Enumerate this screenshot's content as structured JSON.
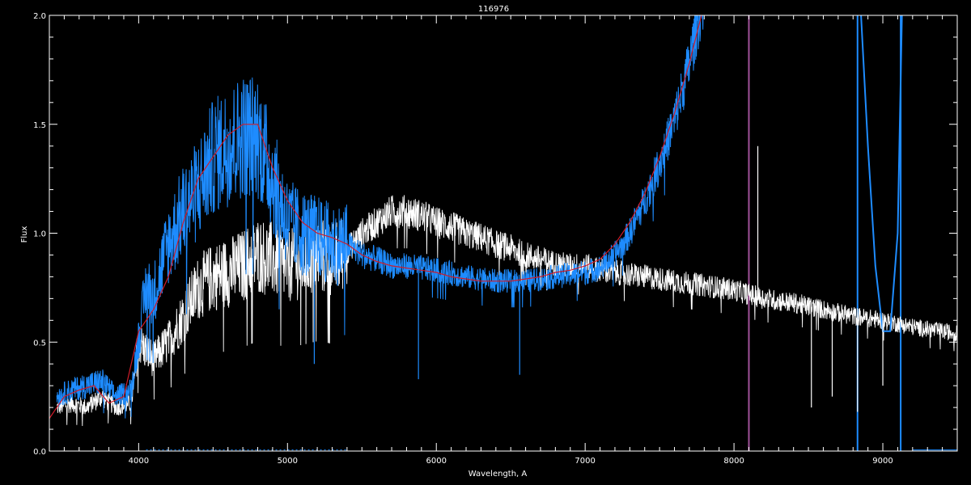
{
  "chart_data": {
    "type": "line",
    "title": "116976",
    "xlabel": "Wavelength, A",
    "ylabel": "Flux",
    "xlim": [
      3400,
      9500
    ],
    "ylim": [
      0.0,
      2.0
    ],
    "x_ticks": [
      4000,
      5000,
      6000,
      7000,
      8000,
      9000
    ],
    "y_ticks": [
      0.0,
      0.5,
      1.0,
      1.5,
      2.0
    ],
    "y_tick_labels": [
      "0.0",
      "0.5",
      "1.0",
      "1.5",
      "2.0"
    ],
    "grid": false,
    "colors": {
      "background": "#000000",
      "axes": "#ffffff",
      "series_white": "#ffffff",
      "series_blue": "#1e8cff",
      "series_red": "#d01c2a",
      "marker_line": "#a0529a"
    },
    "series": [
      {
        "color_key": "series_white",
        "style": "noisy",
        "x": [
          3450,
          3550,
          3650,
          3750,
          3850,
          3950,
          4000,
          4100,
          4200,
          4300,
          4400,
          4500,
          4600,
          4700,
          4800,
          4900,
          5000,
          5100,
          5200,
          5300,
          5400,
          5500,
          5600,
          5700,
          5800,
          5900,
          6000,
          6100,
          6200,
          6300,
          6400,
          6500,
          6600,
          6700,
          6800,
          6900,
          7000,
          7100,
          7200,
          7400,
          7600,
          7800,
          8000,
          8200,
          8400,
          8600,
          8800,
          9000,
          9200,
          9400,
          9500
        ],
        "y": [
          0.2,
          0.22,
          0.2,
          0.25,
          0.2,
          0.22,
          0.5,
          0.42,
          0.5,
          0.62,
          0.75,
          0.8,
          0.82,
          0.85,
          0.9,
          0.88,
          0.85,
          0.87,
          0.9,
          0.88,
          0.92,
          1.0,
          1.05,
          1.1,
          1.1,
          1.08,
          1.05,
          1.03,
          1.0,
          0.98,
          0.95,
          0.93,
          0.9,
          0.88,
          0.86,
          0.85,
          0.85,
          0.83,
          0.82,
          0.8,
          0.78,
          0.76,
          0.74,
          0.7,
          0.68,
          0.65,
          0.62,
          0.6,
          0.57,
          0.55,
          0.54
        ]
      },
      {
        "color_key": "series_blue",
        "style": "noisy",
        "x": [
          3450,
          3550,
          3650,
          3750,
          3850,
          3950,
          4050,
          4100,
          4200,
          4300,
          4400,
          4500,
          4600,
          4700,
          4800,
          4900,
          5000,
          5100,
          5200,
          5300,
          5400,
          5500,
          5600,
          5700,
          5800,
          5900,
          6000,
          6200,
          6400,
          6600,
          6800,
          7000,
          7100,
          7200,
          7300,
          7400,
          7500,
          7600,
          7700,
          7750,
          7800
        ],
        "y": [
          0.25,
          0.28,
          0.3,
          0.32,
          0.25,
          0.28,
          0.75,
          0.72,
          0.95,
          1.1,
          1.2,
          1.35,
          1.4,
          1.45,
          1.45,
          1.25,
          1.05,
          1.0,
          0.98,
          0.95,
          0.95,
          0.9,
          0.88,
          0.85,
          0.85,
          0.84,
          0.83,
          0.8,
          0.78,
          0.78,
          0.8,
          0.82,
          0.84,
          0.9,
          1.0,
          1.15,
          1.32,
          1.52,
          1.78,
          1.95,
          2.1
        ]
      },
      {
        "color_key": "series_blue",
        "style": "smooth",
        "x": [
          8850,
          8900,
          8950,
          9000,
          9050,
          9100,
          9130
        ],
        "y": [
          2.05,
          1.4,
          0.85,
          0.55,
          0.55,
          1.0,
          2.05
        ]
      },
      {
        "color_key": "series_red",
        "style": "smooth",
        "x": [
          3400,
          3500,
          3600,
          3700,
          3800,
          3900,
          4000,
          4100,
          4200,
          4300,
          4400,
          4500,
          4600,
          4700,
          4800,
          4900,
          5000,
          5100,
          5200,
          5300,
          5400,
          5500,
          5600,
          5700,
          5800,
          5900,
          6000,
          6100,
          6200,
          6300,
          6400,
          6500,
          6600,
          6700,
          6800,
          6900,
          7000,
          7100,
          7200,
          7300,
          7400,
          7500,
          7600,
          7700,
          7800
        ],
        "y": [
          0.15,
          0.25,
          0.28,
          0.3,
          0.22,
          0.25,
          0.55,
          0.65,
          0.8,
          1.05,
          1.25,
          1.35,
          1.45,
          1.5,
          1.5,
          1.3,
          1.15,
          1.05,
          1.0,
          0.98,
          0.95,
          0.9,
          0.87,
          0.85,
          0.84,
          0.83,
          0.82,
          0.8,
          0.79,
          0.78,
          0.78,
          0.78,
          0.79,
          0.8,
          0.82,
          0.83,
          0.85,
          0.88,
          0.95,
          1.05,
          1.18,
          1.35,
          1.55,
          1.78,
          2.05
        ]
      }
    ],
    "vertical_lines": [
      {
        "x": 8100,
        "color_key": "marker_line",
        "width": 2
      },
      {
        "x": 8830,
        "color_key": "series_blue",
        "width": 2
      },
      {
        "x": 9120,
        "color_key": "series_blue",
        "width": 2
      }
    ],
    "spikes": [
      {
        "x": 5880,
        "y": 0.33,
        "color_key": "series_blue"
      },
      {
        "x": 6560,
        "y": 0.35,
        "color_key": "series_blue"
      },
      {
        "x": 5180,
        "y": 0.4,
        "color_key": "series_blue"
      },
      {
        "x": 8160,
        "y": 1.4,
        "color_key": "series_white"
      },
      {
        "x": 8520,
        "y": 0.2,
        "color_key": "series_white"
      },
      {
        "x": 8660,
        "y": 0.25,
        "color_key": "series_white"
      },
      {
        "x": 8830,
        "y": 0.18,
        "color_key": "series_white"
      },
      {
        "x": 9000,
        "y": 0.3,
        "color_key": "series_white"
      }
    ]
  }
}
